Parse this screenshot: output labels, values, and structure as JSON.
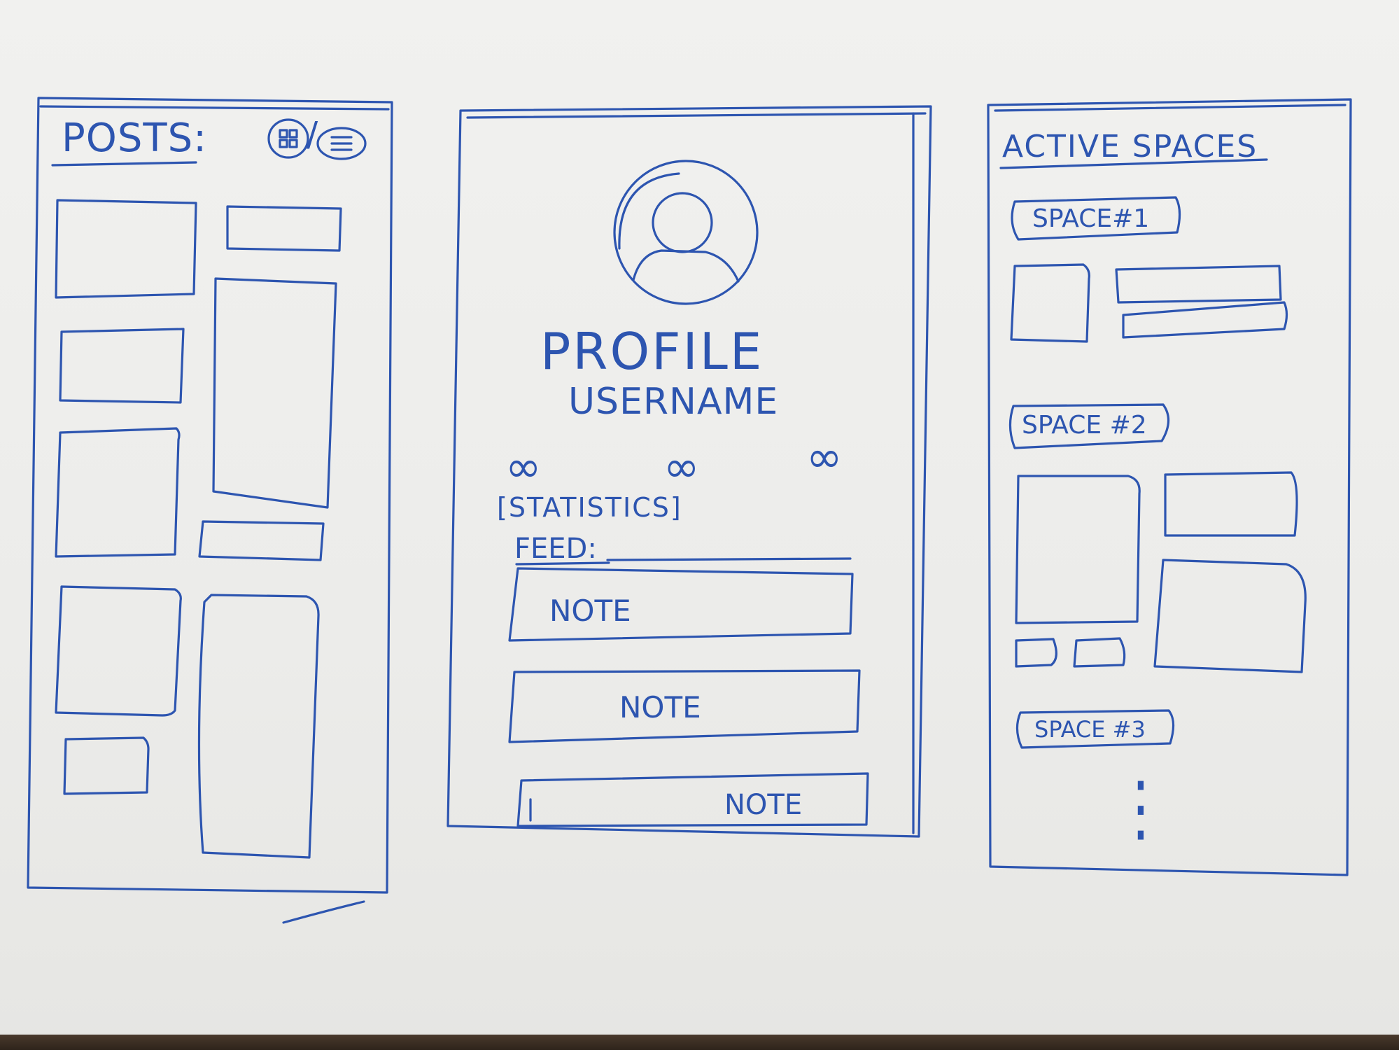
{
  "ink_color": "#2d55b0",
  "posts_screen": {
    "title": "POSTS:",
    "grid_view_icon": "grid-icon",
    "list_view_icon": "list-icon",
    "separator": "/"
  },
  "profile_screen": {
    "avatar_icon": "user-avatar-icon",
    "title": "PROFILE",
    "username": "USERNAME",
    "stat_values": [
      "∞",
      "∞",
      "∞"
    ],
    "statistics_label": "[STATISTICS]",
    "feed_label": "FEED:",
    "notes": [
      "NOTE",
      "NOTE",
      "NOTE"
    ]
  },
  "spaces_screen": {
    "title": "ACTIVE SPACES",
    "spaces": [
      "SPACE#1",
      "SPACE #2",
      "SPACE #3"
    ],
    "more_indicator": "⋮"
  }
}
